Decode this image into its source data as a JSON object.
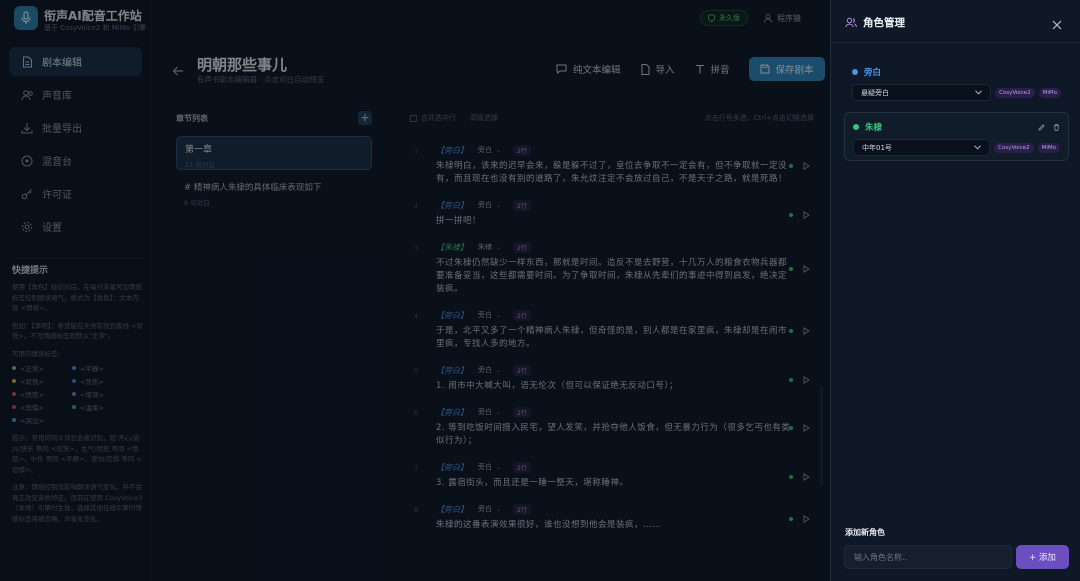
{
  "app": {
    "title": "衔声AI配音工作站",
    "subtitle": "基于 CosyVoice2 和 MiMo 引擎"
  },
  "nav": {
    "items": [
      {
        "label": "剧本编辑",
        "icon": "document-icon",
        "active": true
      },
      {
        "label": "声音库",
        "icon": "users-icon",
        "active": false
      },
      {
        "label": "批量导出",
        "icon": "download-icon",
        "active": false
      },
      {
        "label": "混音台",
        "icon": "mixer-icon",
        "active": false
      },
      {
        "label": "许可证",
        "icon": "key-icon",
        "active": false
      },
      {
        "label": "设置",
        "icon": "gear-icon",
        "active": false
      }
    ]
  },
  "tips": {
    "title": "快捷提示",
    "p1": "使用【角色】标记对白，在每行末尾可加情感标签控制朗读语气。格式为【角色】：文本内容 <情感>。",
    "p2": "例如：【李明】：希望能在天亮前找到客栈 <欢快>。不写情感标签则默认\"正常\"。",
    "emotions_title": "可用的情感标签：",
    "emotions": [
      {
        "label": "<正常>",
        "color": "#9aa4b2"
      },
      {
        "label": "<平静>",
        "color": "#5a8fd0"
      },
      {
        "label": "<欢快>",
        "color": "#e0b13a"
      },
      {
        "label": "<悲伤>",
        "color": "#5b7bd6"
      },
      {
        "label": "<愤怒>",
        "color": "#d9534f"
      },
      {
        "label": "<惊讶>",
        "color": "#a168d8"
      },
      {
        "label": "<恐惧>",
        "color": "#c94c6b"
      },
      {
        "label": "<温柔>",
        "color": "#48b07a"
      },
      {
        "label": "<哭泣>",
        "color": "#4f9bd9"
      }
    ],
    "p3": "提示：常用的同义词也会被识别，如 开心/高兴/快乐 等同 <欢快>，生气/愤怒 等同 <愤怒>，中性 等同 <平静>，害怕/恐惧 等同 <恐惧>。",
    "p4": "注意：情感控制仅影响朗读语气变化，并不会真正改变音色特征。目前在使用 CosyVoice3（本地）引擎时生效，选择其他在线引擎时情感标签将被忽略，声音无变化。"
  },
  "topbar": {
    "license_badge": "永久版",
    "user": "程序猿"
  },
  "page": {
    "title": "明朝那些事儿",
    "subtitle": "有声书剧本编辑器 · 点击对白自动预览"
  },
  "toolbar": {
    "plain_text": "纯文本编辑",
    "import": "导入",
    "pinyin": "拼音",
    "save": "保存剧本"
  },
  "chapters": {
    "header": "章节列表",
    "add": "+",
    "items": [
      {
        "name": "第一章",
        "count": "11 句对白",
        "active": true
      },
      {
        "name": "# 精神病人朱棣的具体临床表现如下",
        "count": "8 句对白",
        "active": false
      }
    ]
  },
  "script": {
    "merge": "合并选中行",
    "advanced": "高级选择",
    "hint": "点击行号多选，Ctrl+点击切换选择",
    "lines": [
      {
        "num": "1",
        "tag": "【旁白】",
        "tag_color": "#4e8fe0",
        "role": "旁白",
        "badge": "2行",
        "text": "朱棣明白，该来的迟早会来，躲是躲不过了，皇位去争取不一定会有，但不争取就一定没有，而且现在也没有别的道路了，朱允炆注定不会放过自己，不是天子之路，就是死路！"
      },
      {
        "num": "2",
        "tag": "【旁白】",
        "tag_color": "#4e8fe0",
        "role": "旁白",
        "badge": "2行",
        "text": "拼一拼吧！"
      },
      {
        "num": "3",
        "tag": "【朱棣】",
        "tag_color": "#3ec27a",
        "role": "朱棣",
        "badge": "2行",
        "text": "不过朱棣仍然缺少一样东西，那就是时间。造反不是去野营，十几万人的粮食衣物兵器都要准备妥当，这些都需要时间。为了争取时间，朱棣从先辈们的事迹中得到启发，绝决定装疯。"
      },
      {
        "num": "4",
        "tag": "【旁白】",
        "tag_color": "#4e8fe0",
        "role": "旁白",
        "badge": "2行",
        "text": "于是，北平又多了一个精神病人朱棣，但奇怪的是，别人都是在家里疯，朱棣却是在闹市里疯，专找人多的地方。"
      },
      {
        "num": "5",
        "tag": "【旁白】",
        "tag_color": "#4e8fe0",
        "role": "旁白",
        "badge": "2行",
        "text": "1. 闹市中大喊大叫，语无伦次（但可以保证绝无反动口号）；"
      },
      {
        "num": "6",
        "tag": "【旁白】",
        "tag_color": "#4e8fe0",
        "role": "旁白",
        "badge": "2行",
        "text": "2. 等到吃饭时间擅入民宅，望人发笑，并抢夺他人饭食，但无暴力行为（很多乞丐也有类似行为）；"
      },
      {
        "num": "7",
        "tag": "【旁白】",
        "tag_color": "#4e8fe0",
        "role": "旁白",
        "badge": "2行",
        "text": "3. 露宿街头，而且还是一睡一整天，堪称睡神。"
      },
      {
        "num": "8",
        "tag": "【旁白】",
        "tag_color": "#4e8fe0",
        "role": "旁白",
        "badge": "2行",
        "text": "朱棣的这番表演效果很好，谁也没想到他会是装疯，……"
      }
    ]
  },
  "roles": {
    "title": "角色管理",
    "items": [
      {
        "name": "旁白",
        "color": "#4d93ea",
        "voice": "悬疑旁白",
        "engines": [
          "CosyVoice2",
          "MiMo"
        ]
      },
      {
        "name": "朱棣",
        "color": "#3ec27a",
        "voice": "中年01号",
        "engines": [
          "CosyVoice2",
          "MiMo"
        ]
      }
    ],
    "add_title": "添加新角色",
    "add_placeholder": "输入角色名称..",
    "add_button": "+ 添加"
  }
}
